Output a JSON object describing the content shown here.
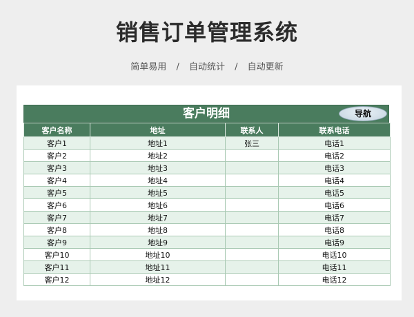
{
  "page": {
    "title": "销售订单管理系统",
    "subtitle_items": [
      "简单易用",
      "自动统计",
      "自动更新"
    ],
    "separator": "/"
  },
  "sheet": {
    "table_title": "客户明细",
    "nav_button_label": "导航",
    "columns": [
      "客户名称",
      "地址",
      "联系人",
      "联系电话"
    ],
    "rows": [
      [
        "客户1",
        "地址1",
        "张三",
        "电话1"
      ],
      [
        "客户2",
        "地址2",
        "",
        "电话2"
      ],
      [
        "客户3",
        "地址3",
        "",
        "电话3"
      ],
      [
        "客户4",
        "地址4",
        "",
        "电话4"
      ],
      [
        "客户5",
        "地址5",
        "",
        "电话5"
      ],
      [
        "客户6",
        "地址6",
        "",
        "电话6"
      ],
      [
        "客户7",
        "地址7",
        "",
        "电话7"
      ],
      [
        "客户8",
        "地址8",
        "",
        "电话8"
      ],
      [
        "客户9",
        "地址9",
        "",
        "电话9"
      ],
      [
        "客户10",
        "地址10",
        "",
        "电话10"
      ],
      [
        "客户11",
        "地址11",
        "",
        "电话11"
      ],
      [
        "客户12",
        "地址12",
        "",
        "电话12"
      ]
    ]
  },
  "colors": {
    "header_green": "#4a7c5e",
    "row_alt": "#e6f2ea"
  }
}
